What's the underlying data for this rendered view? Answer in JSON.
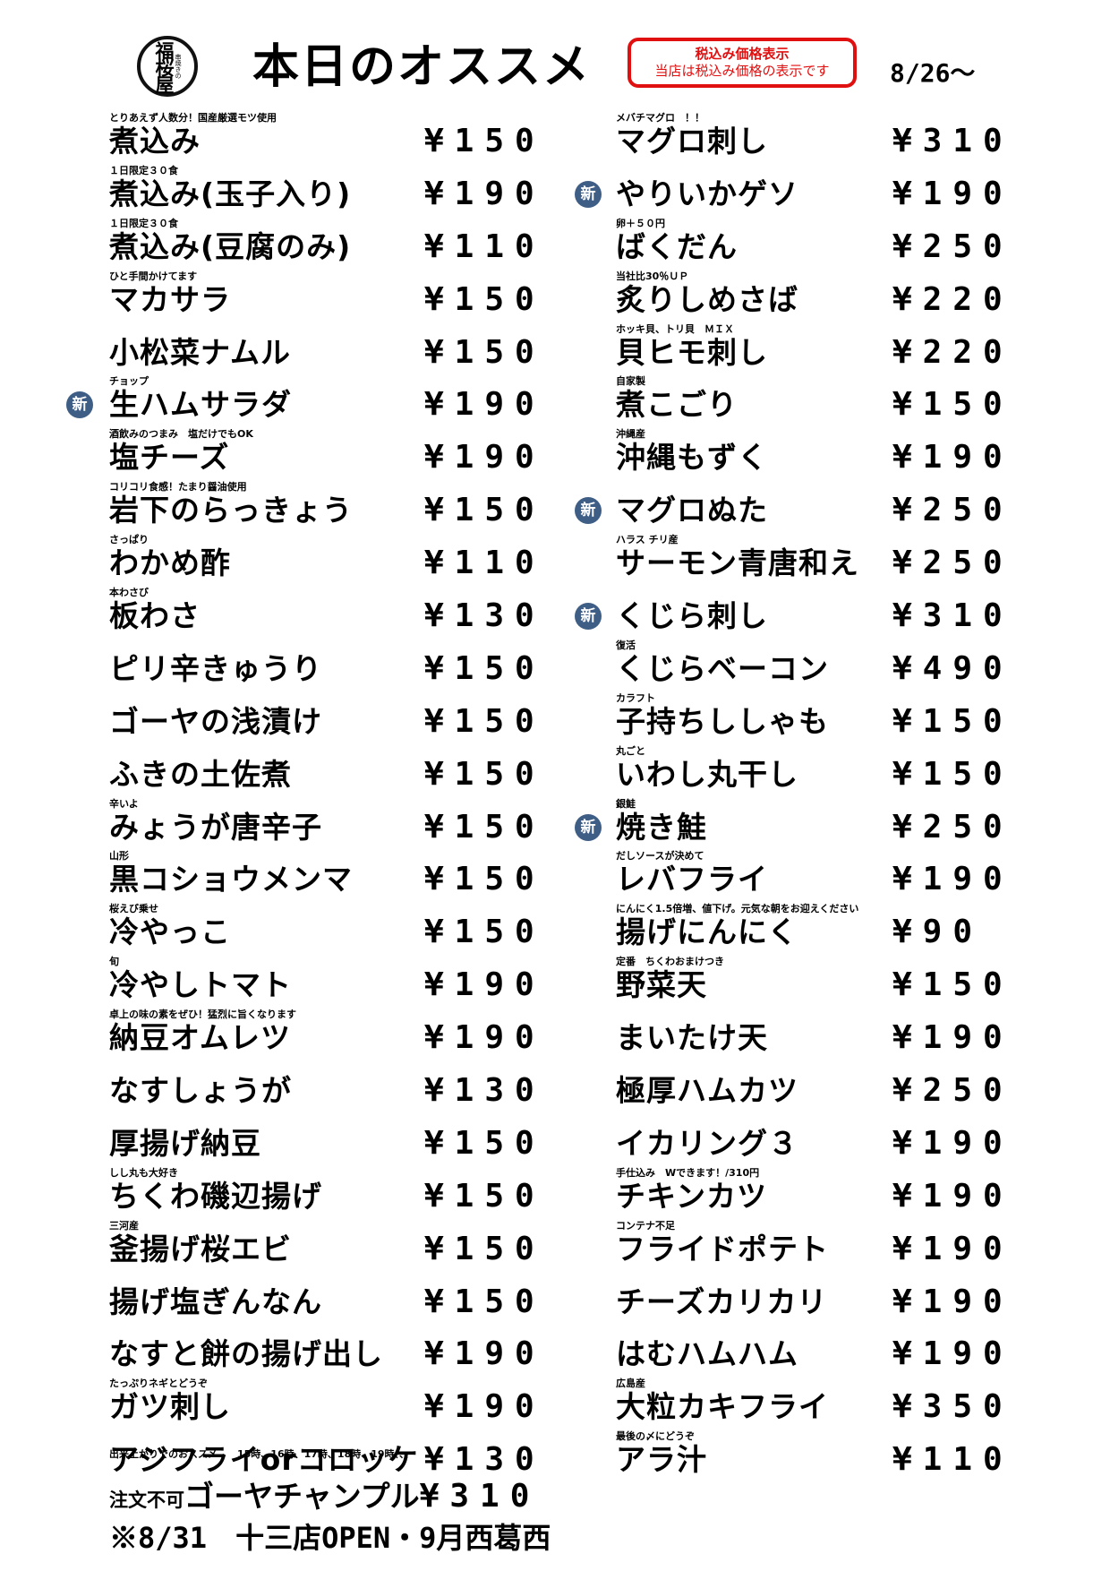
{
  "header": {
    "logo_text": "福桜屋",
    "logo_small": "串焼きの",
    "title": "本日のオススメ",
    "tax_title": "税込み価格表示",
    "tax_note": "当店は税込み価格の表示です",
    "date": "8/26〜"
  },
  "left_items": [
    {
      "note": "とりあえず人数分！国産厳選モツ使用",
      "name": "煮込み",
      "price": "¥150",
      "new": false
    },
    {
      "note": "１日限定３０食",
      "name": "煮込み(玉子入り)",
      "price": "¥190",
      "new": false
    },
    {
      "note": "１日限定３０食",
      "name": "煮込み(豆腐のみ)",
      "price": "¥110",
      "new": false
    },
    {
      "note": "ひと手間かけてます",
      "name": "マカサラ",
      "price": "¥150",
      "new": false
    },
    {
      "note": "",
      "name": "小松菜ナムル",
      "price": "¥150",
      "new": false
    },
    {
      "note": "チョップ",
      "name": "生ハムサラダ",
      "price": "¥190",
      "new": true
    },
    {
      "note": "酒飲みのつまみ　塩だけでもOK",
      "name": "塩チーズ",
      "price": "¥190",
      "new": false
    },
    {
      "note": "コリコリ食感！たまり醤油使用",
      "name": "岩下のらっきょう",
      "price": "¥150",
      "new": false
    },
    {
      "note": "さっぱり",
      "name": "わかめ酢",
      "price": "¥110",
      "new": false
    },
    {
      "note": "本わさび",
      "name": "板わさ",
      "price": "¥130",
      "new": false
    },
    {
      "note": "",
      "name": "ピリ辛きゅうり",
      "price": "¥150",
      "new": false
    },
    {
      "note": "",
      "name": "ゴーヤの浅漬け",
      "price": "¥150",
      "new": false
    },
    {
      "note": "",
      "name": "ふきの土佐煮",
      "price": "¥150",
      "new": false
    },
    {
      "note": "辛いよ",
      "name": "みょうが唐辛子",
      "price": "¥150",
      "new": false
    },
    {
      "note": "山形",
      "name": "黒コショウメンマ",
      "price": "¥150",
      "new": false
    },
    {
      "note": "桜えび乗せ",
      "name": "冷やっこ",
      "price": "¥150",
      "new": false
    },
    {
      "note": "旬",
      "name": "冷やしトマト",
      "price": "¥190",
      "new": false
    },
    {
      "note": "卓上の味の素をぜひ！猛烈に旨くなります",
      "name": "納豆オムレツ",
      "price": "¥190",
      "new": false
    },
    {
      "note": "",
      "name": "なすしょうが",
      "price": "¥130",
      "new": false
    },
    {
      "note": "",
      "name": "厚揚げ納豆",
      "price": "¥150",
      "new": false
    },
    {
      "note": "しし丸も大好き",
      "name": "ちくわ磯辺揚げ",
      "price": "¥150",
      "new": false
    },
    {
      "note": "三河産",
      "name": "釜揚げ桜エビ",
      "price": "¥150",
      "new": false
    },
    {
      "note": "",
      "name": "揚げ塩ぎんなん",
      "price": "¥150",
      "new": false
    },
    {
      "note": "",
      "name": "なすと餅の揚げ出し",
      "price": "¥190",
      "new": false
    },
    {
      "note": "たっぷりネギとどうぞ",
      "name": "ガツ刺し",
      "price": "¥190",
      "new": false
    },
    {
      "note": "",
      "name": "アジフライorコロッケ",
      "price": "¥130",
      "new": false
    }
  ],
  "right_items": [
    {
      "note": "メバチマグロ　！！",
      "name": "マグロ刺し",
      "price": "¥310",
      "new": false
    },
    {
      "note": "",
      "name": "やりいかゲソ",
      "price": "¥190",
      "new": true
    },
    {
      "note": "卵＋５０円",
      "name": "ばくだん",
      "price": "¥250",
      "new": false
    },
    {
      "note": "当社比30％ＵＰ",
      "name": "炙りしめさば",
      "price": "¥220",
      "new": false
    },
    {
      "note": "ホッキ貝、トリ貝　ＭＩＸ",
      "name": "貝ヒモ刺し",
      "price": "¥220",
      "new": false
    },
    {
      "note": "自家製",
      "name": "煮こごり",
      "price": "¥150",
      "new": false
    },
    {
      "note": "沖縄産",
      "name": "沖縄もずく",
      "price": "¥190",
      "new": false
    },
    {
      "note": "",
      "name": "マグロぬた",
      "price": "¥250",
      "new": true
    },
    {
      "note": "ハラス チリ産",
      "name": "サーモン青唐和え",
      "price": "¥250",
      "new": false
    },
    {
      "note": "",
      "name": "くじら刺し",
      "price": "¥310",
      "new": true
    },
    {
      "note": "復活",
      "name": "くじらベーコン",
      "price": "¥490",
      "new": false
    },
    {
      "note": "カラフト",
      "name": "子持ちししゃも",
      "price": "¥150",
      "new": false
    },
    {
      "note": "丸ごと",
      "name": "いわし丸干し",
      "price": "¥150",
      "new": false
    },
    {
      "note": "銀鮭",
      "name": "焼き鮭",
      "price": "¥250",
      "new": true
    },
    {
      "note": "だしソースが決めて",
      "name": "レバフライ",
      "price": "¥190",
      "new": false
    },
    {
      "note": "にんにく1.5倍増、値下げ。元気な朝をお迎えください",
      "name": "揚げにんにく",
      "price": " ¥90",
      "new": false
    },
    {
      "note": "定番　ちくわおまけつき",
      "name": "野菜天",
      "price": "¥150",
      "new": false
    },
    {
      "note": "",
      "name": "まいたけ天",
      "price": "¥190",
      "new": false
    },
    {
      "note": "",
      "name": "極厚ハムカツ",
      "price": "¥250",
      "new": false
    },
    {
      "note": "",
      "name": "イカリング３",
      "price": "¥190",
      "new": false
    },
    {
      "note": "手仕込み　Wできます！/310円",
      "name": "チキンカツ",
      "price": "¥190",
      "new": false
    },
    {
      "note": "コンテナ不足",
      "name": "フライドポテト",
      "price": "¥190",
      "new": false
    },
    {
      "note": "",
      "name": "チーズカリカリ",
      "price": "¥190",
      "new": false
    },
    {
      "note": "",
      "name": "はむハムハム",
      "price": "¥190",
      "new": false
    },
    {
      "note": "広島産",
      "name": "大粒カキフライ",
      "price": "¥350",
      "new": false
    },
    {
      "note": "最後の〆にどうぞ",
      "name": "アラ汁",
      "price": "¥110",
      "new": false
    }
  ],
  "new_badge_label": "新",
  "special": {
    "note": "出来上がりでのおススメ　　15時、16時、17時、18時、19時、、、",
    "prefix": "注文不可",
    "name": "ゴーヤチャンプル",
    "price": "¥310"
  },
  "footer": "※8/31　十三店OPEN・9月西葛西"
}
